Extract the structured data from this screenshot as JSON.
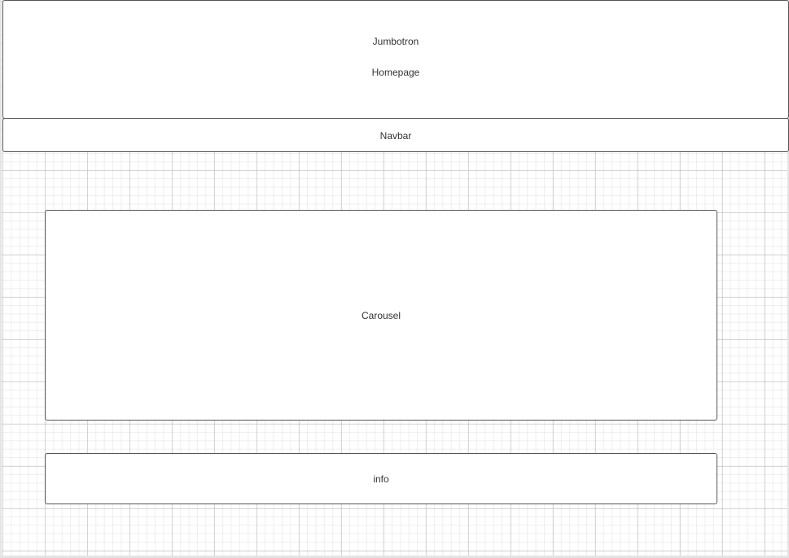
{
  "diagram": {
    "jumbotron": {
      "title": "Jumbotron",
      "subtitle": "Homepage"
    },
    "navbar": {
      "label": "Navbar"
    },
    "carousel": {
      "label": "Carousel"
    },
    "info": {
      "label": "info"
    }
  },
  "colors": {
    "box_border": "#555555",
    "box_fill": "#ffffff",
    "grid_line": "#d0d0d0",
    "text": "#333333"
  }
}
